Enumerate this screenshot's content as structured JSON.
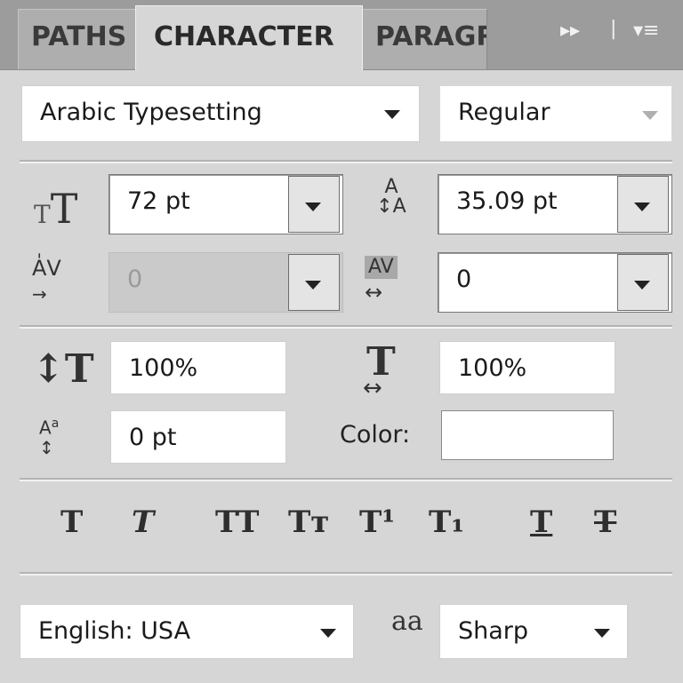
{
  "tabs": [
    {
      "label": "PATHS"
    },
    {
      "label": "CHARACTER"
    },
    {
      "label": "PARAGRAPH"
    }
  ],
  "tab_extras": {
    "collapse": "▸▸",
    "separator": "|",
    "menu": "▾≡"
  },
  "font": {
    "family": "Arabic Typesetting",
    "style": "Regular"
  },
  "size": {
    "value": "72 pt"
  },
  "leading": {
    "value": "35.09 pt"
  },
  "kerning": {
    "value": "0"
  },
  "tracking": {
    "value": "0"
  },
  "vertical_scale": {
    "value": "100%"
  },
  "horizontal_scale": {
    "value": "100%"
  },
  "baseline_shift": {
    "value": "0 pt"
  },
  "color": {
    "label": "Color:"
  },
  "style_buttons": [
    {
      "glyph": "T"
    },
    {
      "glyph": "T"
    },
    {
      "glyph": "TT"
    },
    {
      "glyph": "Tт"
    },
    {
      "glyph": "T¹"
    },
    {
      "glyph": "T₁"
    },
    {
      "glyph": "T"
    },
    {
      "glyph": "T"
    }
  ],
  "language": {
    "value": "English: USA"
  },
  "antialias": {
    "icon_text": "aa",
    "value": "Sharp"
  }
}
